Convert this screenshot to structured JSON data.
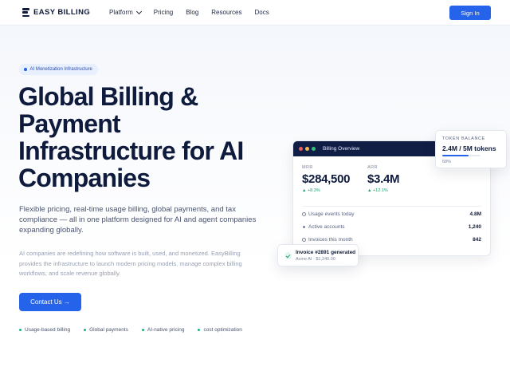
{
  "brand": {
    "name": "EASY BILLING",
    "logo_icon": "stacked-bars-logo-icon"
  },
  "nav": {
    "links": [
      {
        "label": "Platform",
        "has_dropdown": true
      },
      {
        "label": "Pricing"
      },
      {
        "label": "Blog"
      },
      {
        "label": "Resources"
      },
      {
        "label": "Docs"
      }
    ],
    "signin_label": "Sign In"
  },
  "hero": {
    "badge": "AI Monetization Infrastructure",
    "headline_lines": [
      "Global Billing &",
      "Payment",
      "Infrastructure for AI",
      "Companies"
    ],
    "lead": "Flexible pricing, real-time usage billing, global payments, and tax compliance — all in one platform designed for AI and agent companies expanding globally.",
    "sub": "AI companies are redefining how software is built, used, and monetized. EasyBilling provides the infrastructure to launch modern pricing models, manage complex billing workflows, and scale revenue globally.",
    "cta_label": "Contact Us →",
    "features": [
      "Usage-based billing",
      "Global payments",
      "AI-native pricing",
      "cost optimization"
    ]
  },
  "dashboard": {
    "title": "Billing Overview",
    "window_dots": [
      "#ef5b5b",
      "#f5b94a",
      "#33c27a"
    ],
    "metrics": [
      {
        "label": "MRR",
        "value": "$284,500",
        "change": "▲ +8.3%"
      },
      {
        "label": "ARR",
        "value": "$3.4M",
        "change": "▲ +12.1%"
      }
    ],
    "rows": [
      {
        "icon": "clock-icon",
        "label": "Usage events today",
        "value": "4.8M"
      },
      {
        "icon": "dot-icon",
        "label": "Active accounts",
        "value": "1,240"
      },
      {
        "icon": "clock-icon",
        "label": "Invoices this month",
        "value": "842"
      }
    ]
  },
  "token": {
    "label": "TOKEN BALANCE",
    "value": "2.4M / 5M tokens",
    "percent_text": "68%",
    "fill_fraction": 0.68
  },
  "invoice": {
    "title": "Invoice #2891 generated",
    "subtitle": "Acme AI · $1,240.00",
    "icon": "check-icon"
  },
  "colors": {
    "accent": "#2563eb",
    "navy": "#0f1b3d",
    "success": "#19a36c"
  }
}
